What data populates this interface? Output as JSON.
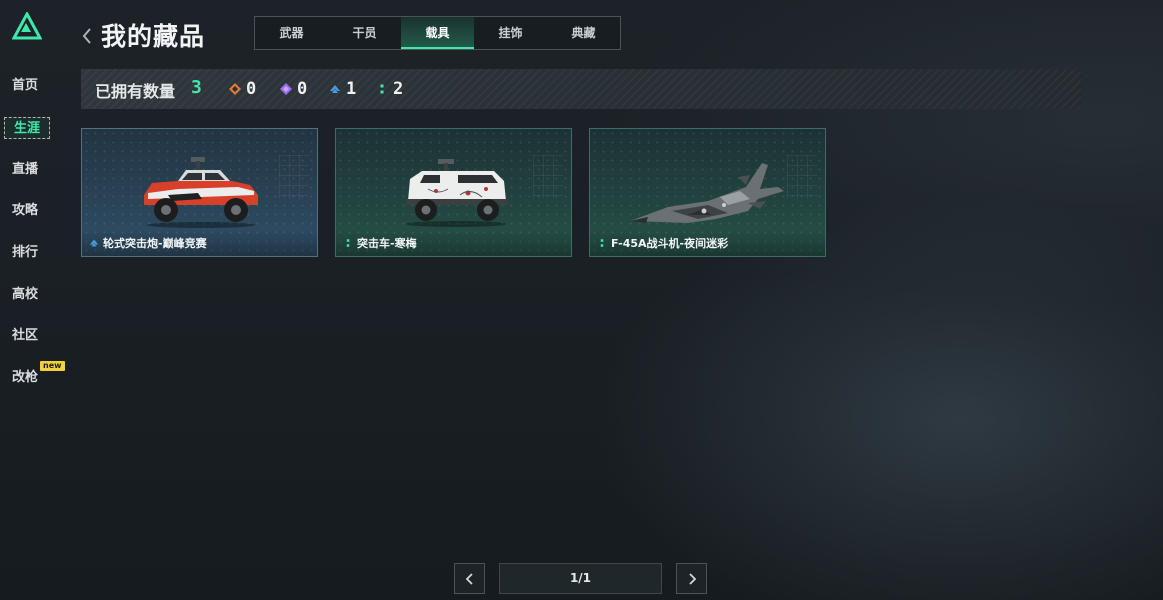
{
  "app": {
    "logo_icon": "triangle-logo-icon",
    "accent_color": "#3ee8a8"
  },
  "sidebar": {
    "items": [
      {
        "label": "首页",
        "active": false
      },
      {
        "label": "生涯",
        "active": true
      },
      {
        "label": "直播",
        "active": false
      },
      {
        "label": "攻略",
        "active": false
      },
      {
        "label": "排行",
        "active": false
      },
      {
        "label": "高校",
        "active": false
      },
      {
        "label": "社区",
        "active": false
      },
      {
        "label": "改枪",
        "active": false,
        "badge": "new"
      }
    ]
  },
  "header": {
    "back_icon": "chevron-left-icon",
    "title": "我的藏品",
    "tabs": [
      {
        "label": "武器",
        "active": false
      },
      {
        "label": "干员",
        "active": false
      },
      {
        "label": "载具",
        "active": true
      },
      {
        "label": "挂饰",
        "active": false
      },
      {
        "label": "典藏",
        "active": false
      }
    ]
  },
  "summary": {
    "label": "已拥有数量",
    "total": "3",
    "stats": [
      {
        "icon": "orange-diamond-icon",
        "color": "#e07a3a",
        "value": "0"
      },
      {
        "icon": "purple-diamond-icon",
        "color": "#9b6bf0",
        "value": "0"
      },
      {
        "icon": "blue-chevron-icon",
        "color": "#4a9be0",
        "value": "1"
      },
      {
        "icon": "green-dots-icon",
        "color": "#3ee8a8",
        "value": "2"
      }
    ]
  },
  "collection": {
    "items": [
      {
        "name": "轮式突击炮-巅峰竞赛",
        "rarity_icon": "blue-chevron-icon",
        "tone": "blue",
        "image": "red-assault-vehicle-image"
      },
      {
        "name": "突击车-寒梅",
        "rarity_icon": "green-dots-icon",
        "tone": "green",
        "image": "white-armored-car-image"
      },
      {
        "name": "F-45A战斗机-夜间迷彩",
        "rarity_icon": "green-dots-icon",
        "tone": "green",
        "image": "camo-fighter-jet-image"
      }
    ]
  },
  "pagination": {
    "current": "1/1",
    "prev_icon": "chevron-left-icon",
    "next_icon": "chevron-right-icon"
  }
}
